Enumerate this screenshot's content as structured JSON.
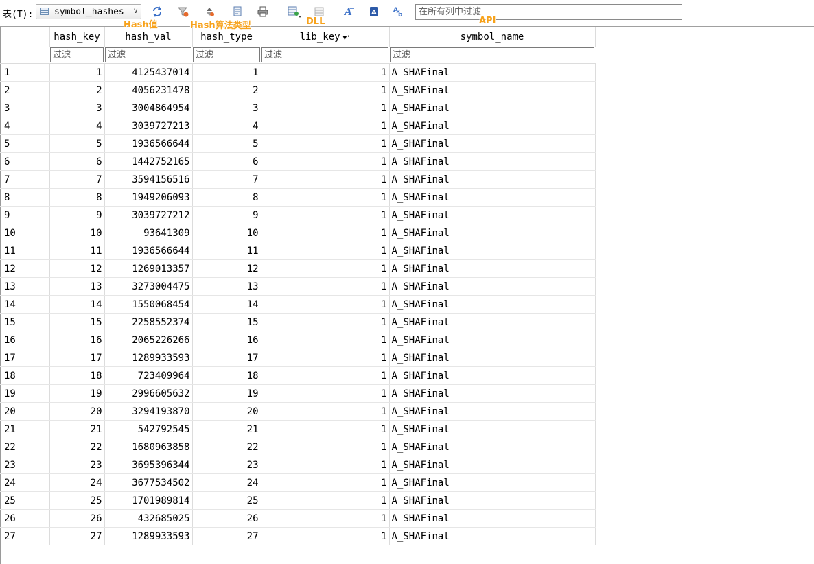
{
  "toolbar": {
    "table_label": "表(T):",
    "table_select_value": "symbol_hashes",
    "search_placeholder": "在所有列中过滤"
  },
  "annotations": {
    "hash_val": "Hash值",
    "hash_type": "Hash算法类型",
    "dll": "DLL",
    "api": "API"
  },
  "grid": {
    "columns": [
      "hash_key",
      "hash_val",
      "hash_type",
      "lib_key",
      "symbol_name"
    ],
    "sort_indicator": "▼'",
    "filter_placeholder": "过滤",
    "rows": [
      {
        "n": "1",
        "hash_key": "1",
        "hash_val": "4125437014",
        "hash_type": "1",
        "lib_key": "1",
        "symbol_name": "A_SHAFinal"
      },
      {
        "n": "2",
        "hash_key": "2",
        "hash_val": "4056231478",
        "hash_type": "2",
        "lib_key": "1",
        "symbol_name": "A_SHAFinal"
      },
      {
        "n": "3",
        "hash_key": "3",
        "hash_val": "3004864954",
        "hash_type": "3",
        "lib_key": "1",
        "symbol_name": "A_SHAFinal"
      },
      {
        "n": "4",
        "hash_key": "4",
        "hash_val": "3039727213",
        "hash_type": "4",
        "lib_key": "1",
        "symbol_name": "A_SHAFinal"
      },
      {
        "n": "5",
        "hash_key": "5",
        "hash_val": "1936566644",
        "hash_type": "5",
        "lib_key": "1",
        "symbol_name": "A_SHAFinal"
      },
      {
        "n": "6",
        "hash_key": "6",
        "hash_val": "1442752165",
        "hash_type": "6",
        "lib_key": "1",
        "symbol_name": "A_SHAFinal"
      },
      {
        "n": "7",
        "hash_key": "7",
        "hash_val": "3594156516",
        "hash_type": "7",
        "lib_key": "1",
        "symbol_name": "A_SHAFinal"
      },
      {
        "n": "8",
        "hash_key": "8",
        "hash_val": "1949206093",
        "hash_type": "8",
        "lib_key": "1",
        "symbol_name": "A_SHAFinal"
      },
      {
        "n": "9",
        "hash_key": "9",
        "hash_val": "3039727212",
        "hash_type": "9",
        "lib_key": "1",
        "symbol_name": "A_SHAFinal"
      },
      {
        "n": "10",
        "hash_key": "10",
        "hash_val": "93641309",
        "hash_type": "10",
        "lib_key": "1",
        "symbol_name": "A_SHAFinal"
      },
      {
        "n": "11",
        "hash_key": "11",
        "hash_val": "1936566644",
        "hash_type": "11",
        "lib_key": "1",
        "symbol_name": "A_SHAFinal"
      },
      {
        "n": "12",
        "hash_key": "12",
        "hash_val": "1269013357",
        "hash_type": "12",
        "lib_key": "1",
        "symbol_name": "A_SHAFinal"
      },
      {
        "n": "13",
        "hash_key": "13",
        "hash_val": "3273004475",
        "hash_type": "13",
        "lib_key": "1",
        "symbol_name": "A_SHAFinal"
      },
      {
        "n": "14",
        "hash_key": "14",
        "hash_val": "1550068454",
        "hash_type": "14",
        "lib_key": "1",
        "symbol_name": "A_SHAFinal"
      },
      {
        "n": "15",
        "hash_key": "15",
        "hash_val": "2258552374",
        "hash_type": "15",
        "lib_key": "1",
        "symbol_name": "A_SHAFinal"
      },
      {
        "n": "16",
        "hash_key": "16",
        "hash_val": "2065226266",
        "hash_type": "16",
        "lib_key": "1",
        "symbol_name": "A_SHAFinal"
      },
      {
        "n": "17",
        "hash_key": "17",
        "hash_val": "1289933593",
        "hash_type": "17",
        "lib_key": "1",
        "symbol_name": "A_SHAFinal"
      },
      {
        "n": "18",
        "hash_key": "18",
        "hash_val": "723409964",
        "hash_type": "18",
        "lib_key": "1",
        "symbol_name": "A_SHAFinal"
      },
      {
        "n": "19",
        "hash_key": "19",
        "hash_val": "2996605632",
        "hash_type": "19",
        "lib_key": "1",
        "symbol_name": "A_SHAFinal"
      },
      {
        "n": "20",
        "hash_key": "20",
        "hash_val": "3294193870",
        "hash_type": "20",
        "lib_key": "1",
        "symbol_name": "A_SHAFinal"
      },
      {
        "n": "21",
        "hash_key": "21",
        "hash_val": "542792545",
        "hash_type": "21",
        "lib_key": "1",
        "symbol_name": "A_SHAFinal"
      },
      {
        "n": "22",
        "hash_key": "22",
        "hash_val": "1680963858",
        "hash_type": "22",
        "lib_key": "1",
        "symbol_name": "A_SHAFinal"
      },
      {
        "n": "23",
        "hash_key": "23",
        "hash_val": "3695396344",
        "hash_type": "23",
        "lib_key": "1",
        "symbol_name": "A_SHAFinal"
      },
      {
        "n": "24",
        "hash_key": "24",
        "hash_val": "3677534502",
        "hash_type": "24",
        "lib_key": "1",
        "symbol_name": "A_SHAFinal"
      },
      {
        "n": "25",
        "hash_key": "25",
        "hash_val": "1701989814",
        "hash_type": "25",
        "lib_key": "1",
        "symbol_name": "A_SHAFinal"
      },
      {
        "n": "26",
        "hash_key": "26",
        "hash_val": "432685025",
        "hash_type": "26",
        "lib_key": "1",
        "symbol_name": "A_SHAFinal"
      },
      {
        "n": "27",
        "hash_key": "27",
        "hash_val": "1289933593",
        "hash_type": "27",
        "lib_key": "1",
        "symbol_name": "A_SHAFinal"
      }
    ]
  },
  "icons": {
    "refresh": "refresh-icon",
    "clear_filter": "clear-filter-icon",
    "sort": "sort-icon",
    "print_preview": "print-preview-icon",
    "print": "print-icon",
    "insert_record": "insert-record-icon",
    "delete_record": "delete-record-icon",
    "font_a": "font-icon",
    "encoding": "encoding-icon",
    "text_transform": "text-transform-icon"
  },
  "colors": {
    "annotation": "#f7a21b",
    "icon_blue": "#3a6fc7"
  }
}
